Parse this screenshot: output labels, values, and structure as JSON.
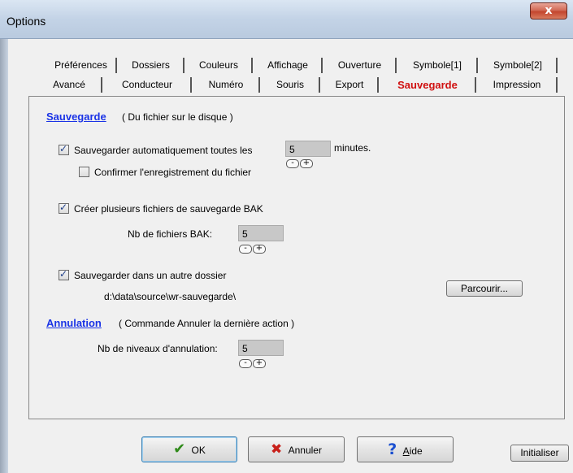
{
  "window": {
    "title": "Options",
    "close_glyph": "x"
  },
  "tabs": {
    "row1": [
      "Préférences",
      "Dossiers",
      "Couleurs",
      "Affichage",
      "Ouverture",
      "Symbole[1]",
      "Symbole[2]"
    ],
    "row2": [
      "Avancé",
      "Conducteur",
      "Numéro",
      "Souris",
      "Export",
      "Sauvegarde",
      "Impression"
    ],
    "active": "Sauvegarde"
  },
  "sauvegarde": {
    "title": "Sauvegarde",
    "desc": "( Du fichier sur le disque )",
    "auto_save": {
      "label": "Sauvegarder automatiquement toutes les",
      "checked": true,
      "value": "5",
      "unit": "minutes."
    },
    "confirm": {
      "label": "Confirmer l'enregistrement du fichier",
      "checked": false
    },
    "bak": {
      "label": "Créer plusieurs fichiers de sauvegarde BAK",
      "checked": true,
      "count_label": "Nb de fichiers BAK:",
      "count_value": "5"
    },
    "other_dir": {
      "label": "Sauvegarder dans un autre dossier",
      "checked": true,
      "path": "d:\\data\\source\\wr-sauvegarde\\",
      "browse_label": "Parcourir..."
    }
  },
  "annulation": {
    "title": "Annulation",
    "desc": "( Commande Annuler la dernière action )",
    "levels_label": "Nb de niveaux d'annulation:",
    "levels_value": "5"
  },
  "spin": {
    "minus": "-",
    "plus": "+"
  },
  "buttons": {
    "ok": "OK",
    "cancel": "Annuler",
    "help": "Aide",
    "reset": "Initialiser"
  },
  "icons": {
    "ok": "checkmark-icon",
    "cancel": "x-icon",
    "help": "question-icon"
  }
}
